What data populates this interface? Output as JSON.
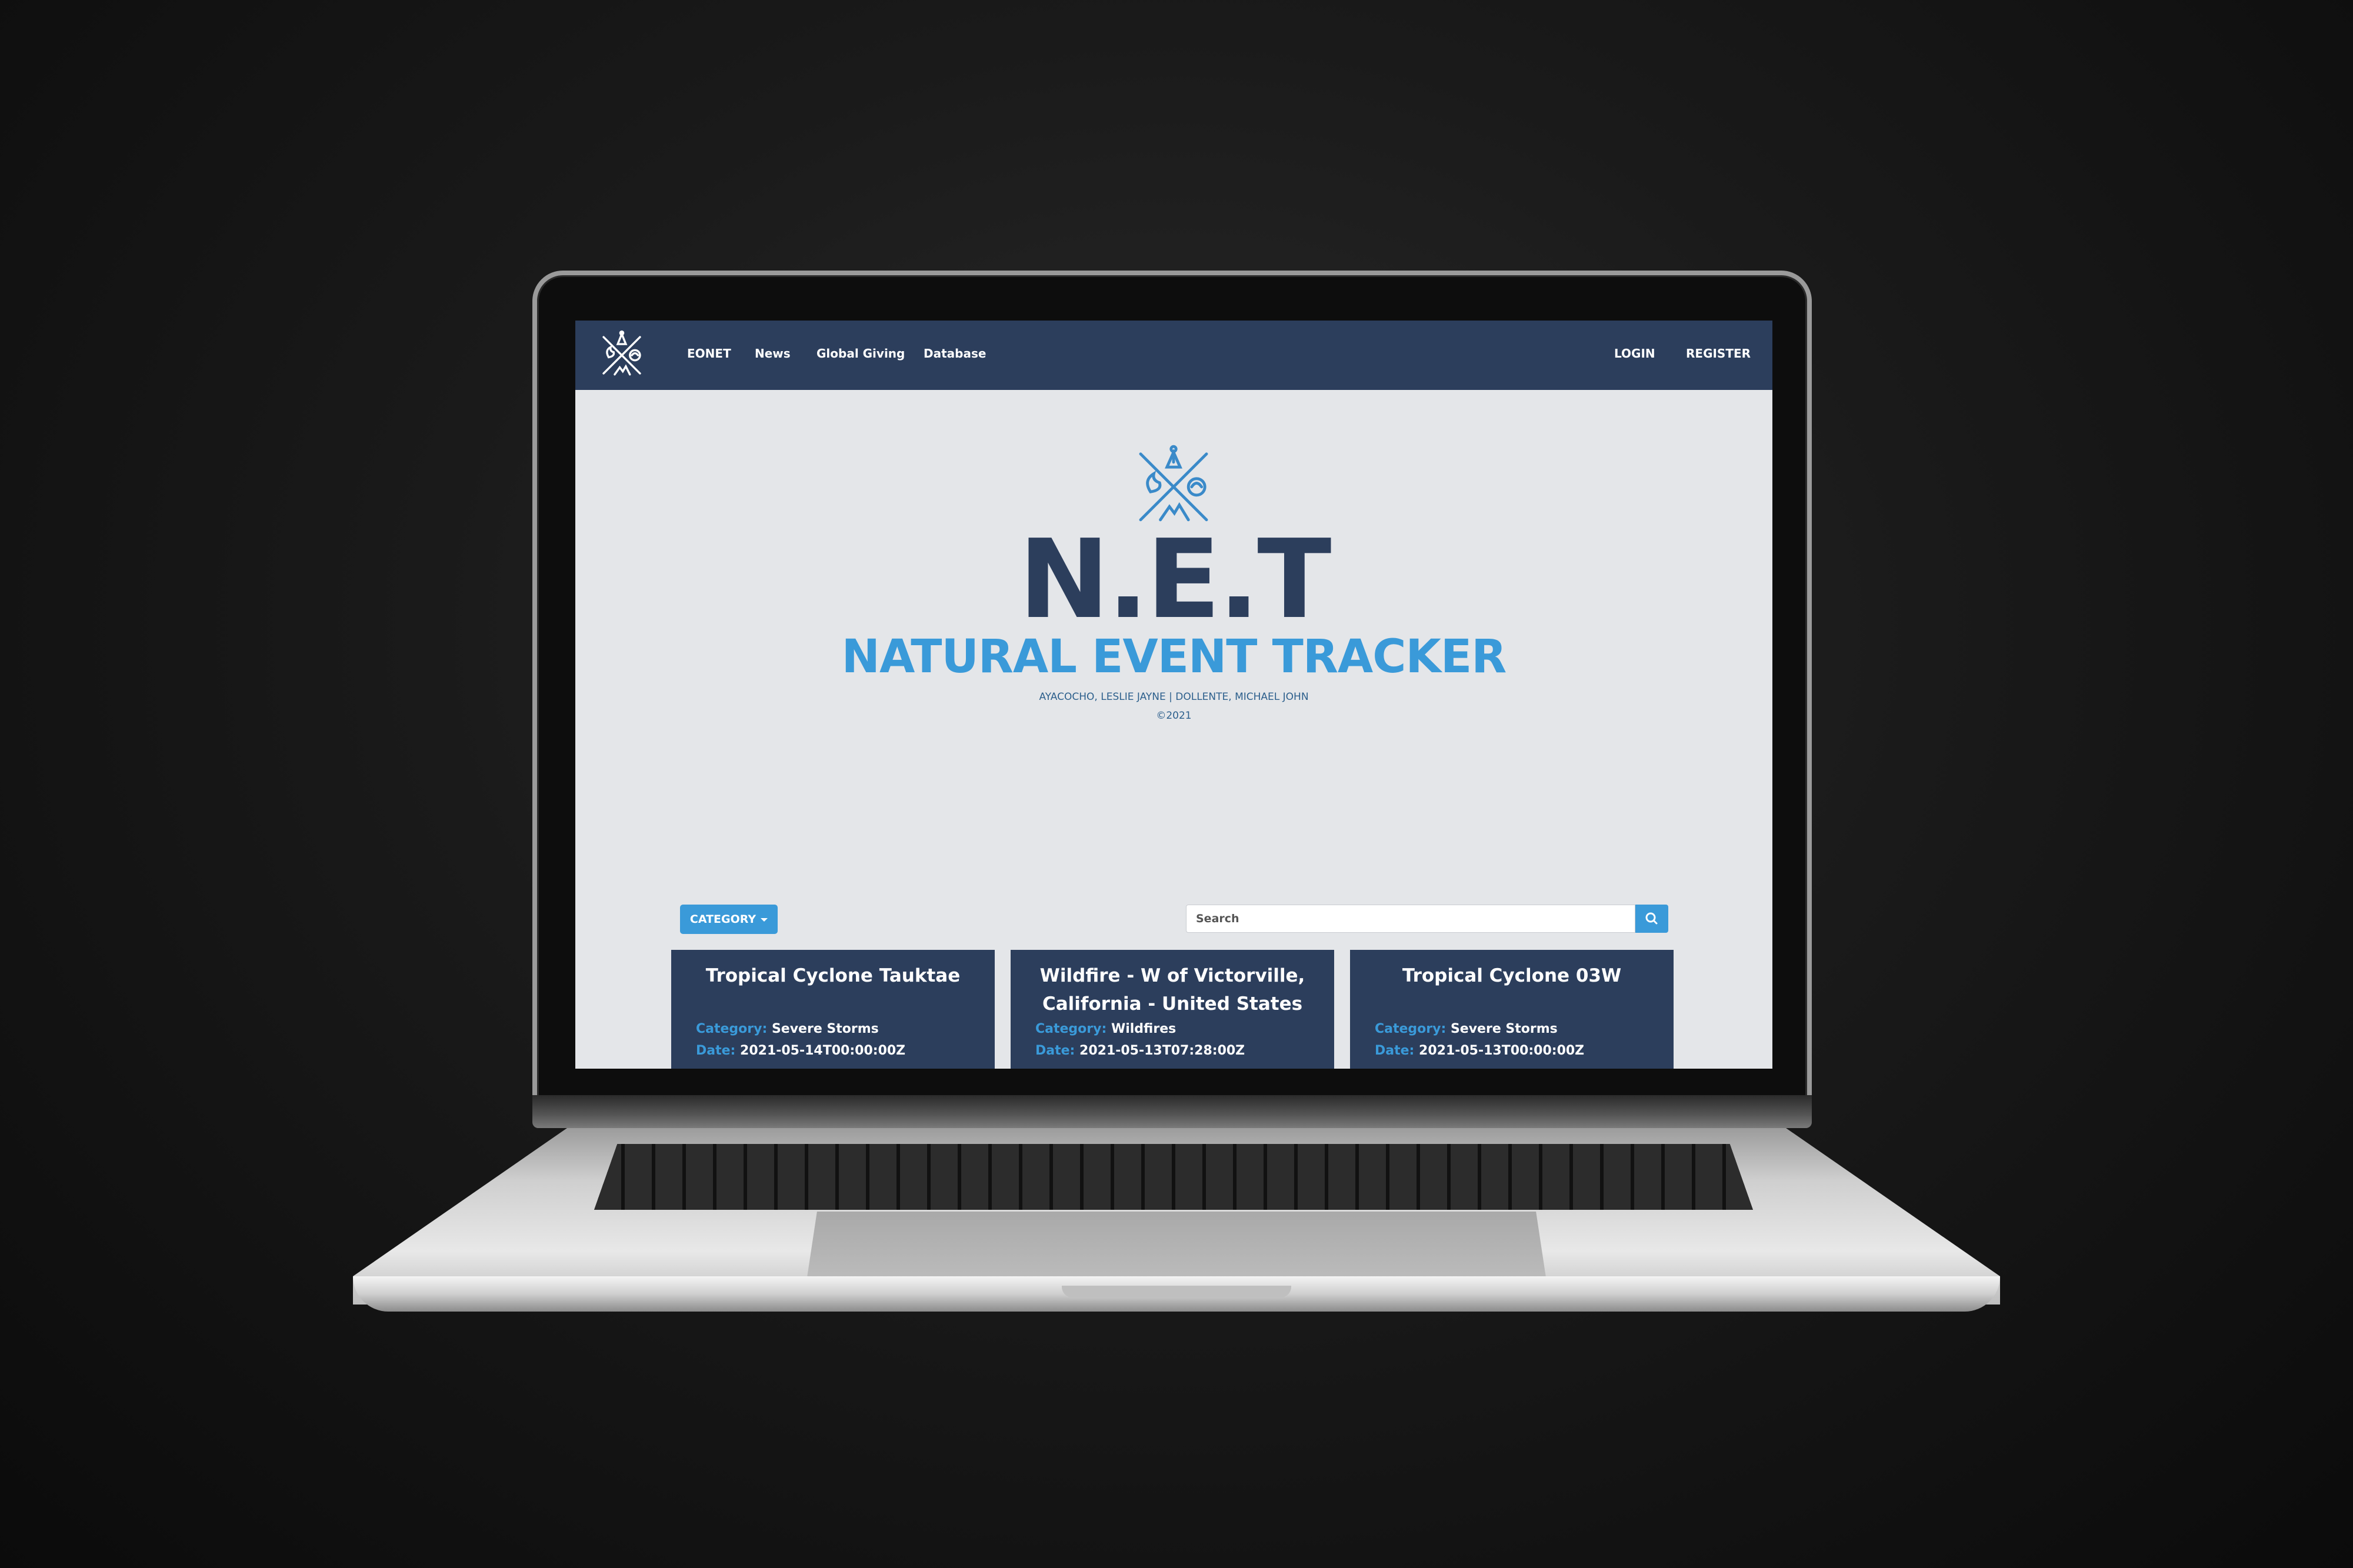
{
  "navbar": {
    "brand_icon": "net-emblem-icon",
    "links": [
      "EONET",
      "News",
      "Global Giving",
      "Database"
    ],
    "login": "LOGIN",
    "register": "REGISTER"
  },
  "hero": {
    "emblem": "net-emblem-icon",
    "title": "N.E.T",
    "subtitle": "NATURAL EVENT TRACKER",
    "authors": "AYACOCHO, LESLIE JAYNE | DOLLENTE, MICHAEL JOHN",
    "copyright": "©2021"
  },
  "toolbar": {
    "category_label": "CATEGORY",
    "search_placeholder": "Search",
    "search_icon": "search-icon"
  },
  "events": [
    {
      "title": "Tropical Cyclone Tauktae",
      "category_key": "Category:",
      "category": "Severe Storms",
      "date_key": "Date:",
      "date": "2021-05-14T00:00:00Z"
    },
    {
      "title": "Wildfire - W of Victorville, California - United States",
      "category_key": "Category:",
      "category": "Wildfires",
      "date_key": "Date:",
      "date": "2021-05-13T07:28:00Z"
    },
    {
      "title": "Tropical Cyclone 03W",
      "category_key": "Category:",
      "category": "Severe Storms",
      "date_key": "Date:",
      "date": "2021-05-13T00:00:00Z"
    }
  ],
  "colors": {
    "navbar": "#2c3e5c",
    "accent": "#3a9ad9",
    "page_bg": "#e4e6e9"
  }
}
